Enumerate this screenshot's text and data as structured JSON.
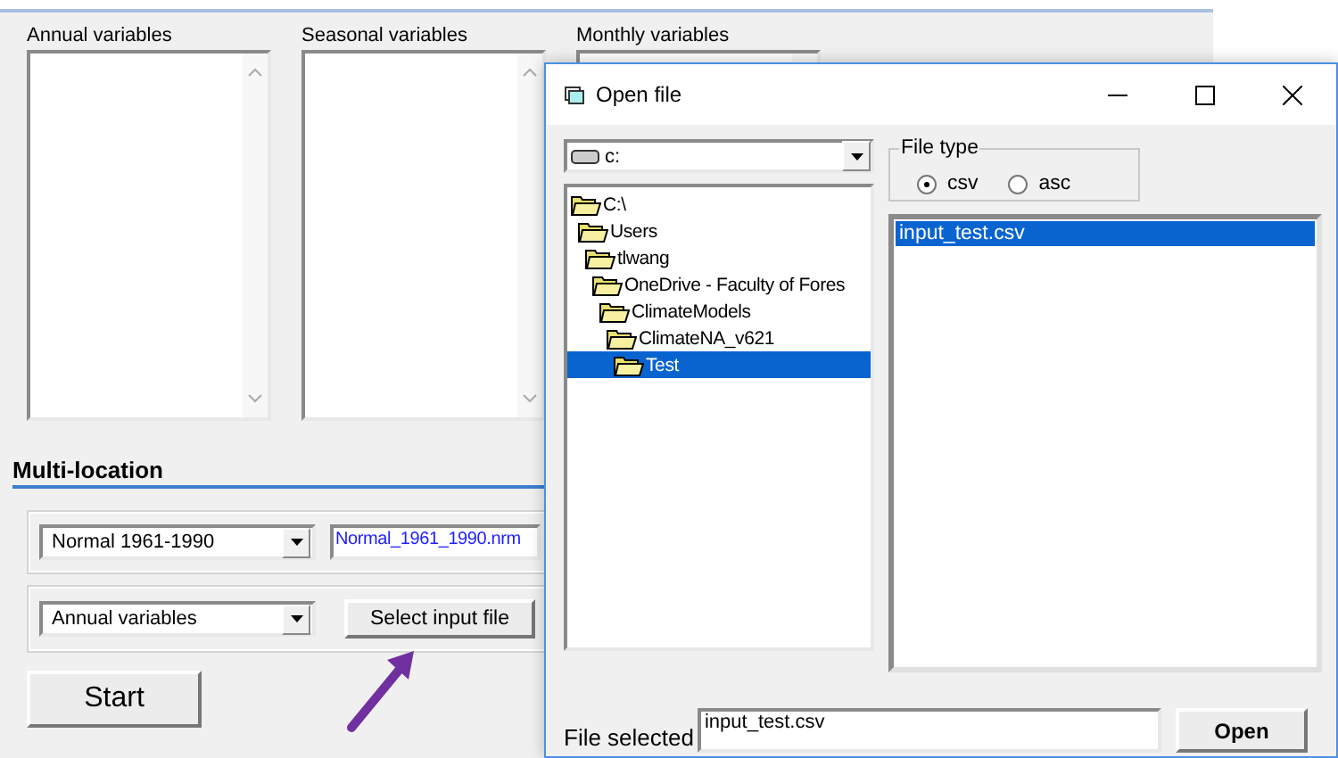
{
  "main": {
    "lists": [
      {
        "label": "Annual variables"
      },
      {
        "label": "Seasonal variables"
      },
      {
        "label": "Monthly variables"
      }
    ],
    "section_title": "Multi-location",
    "period_select": {
      "value": "Normal 1961-1990"
    },
    "normal_file": {
      "value": "Normal_1961_1990.nrm"
    },
    "variables_select": {
      "value": "Annual variables"
    },
    "select_button": "Select input file",
    "start_button": "Start"
  },
  "dialog": {
    "title": "Open file",
    "drive": {
      "value": "c:"
    },
    "folders": [
      {
        "name": "C:\\",
        "selected": false,
        "children": [
          {
            "name": "Users",
            "selected": false,
            "children": [
              {
                "name": "tlwang",
                "selected": false,
                "children": [
                  {
                    "name": "OneDrive - Faculty of Fores",
                    "selected": false,
                    "children": [
                      {
                        "name": "ClimateModels",
                        "selected": false,
                        "children": [
                          {
                            "name": "ClimateNA_v621",
                            "selected": false,
                            "children": [
                              {
                                "name": "Test",
                                "selected": true
                              }
                            ]
                          }
                        ]
                      }
                    ]
                  }
                ]
              }
            ]
          }
        ]
      }
    ],
    "file_type": {
      "label": "File type",
      "options": [
        {
          "label": "csv",
          "selected": true
        },
        {
          "label": "asc",
          "selected": false
        }
      ]
    },
    "files": [
      {
        "name": "input_test.csv",
        "selected": true
      }
    ],
    "file_selected": {
      "label": "File selected",
      "value": "input_test.csv"
    },
    "open_button": "Open"
  }
}
